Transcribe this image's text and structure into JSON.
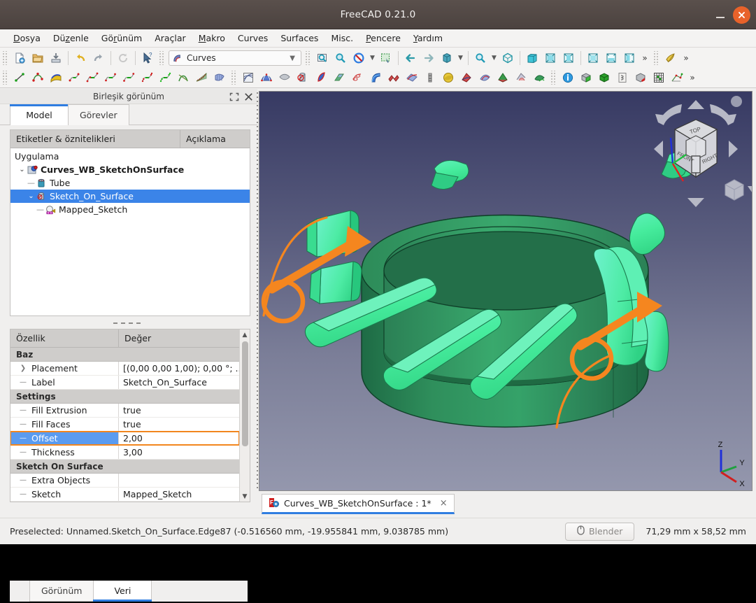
{
  "window": {
    "title": "FreeCAD 0.21.0",
    "minimize_label": "minimize",
    "close_label": "close"
  },
  "menubar": {
    "items": [
      {
        "label": "Dosya",
        "mnemonic": "D"
      },
      {
        "label": "Düzenle",
        "mnemonic": "z"
      },
      {
        "label": "Görünüm",
        "mnemonic": "r"
      },
      {
        "label": "Araçlar",
        "mnemonic": ""
      },
      {
        "label": "Makro",
        "mnemonic": "M"
      },
      {
        "label": "Curves",
        "mnemonic": ""
      },
      {
        "label": "Surfaces",
        "mnemonic": ""
      },
      {
        "label": "Misc.",
        "mnemonic": ""
      },
      {
        "label": "Pencere",
        "mnemonic": "P"
      },
      {
        "label": "Yardım",
        "mnemonic": "Y"
      }
    ]
  },
  "toolbar": {
    "workbench_selector": {
      "value": "Curves",
      "icon": "curves-workbench-icon"
    },
    "row1_icons": [
      "new-document-icon",
      "open-document-icon",
      "save-document-icon",
      "undo-icon",
      "redo-icon",
      "refresh-icon",
      "whats-this-icon"
    ],
    "row1_view_icons": [
      "fit-all-icon",
      "fit-selection-icon",
      "draw-style-icon",
      "box-selection-icon",
      "back-icon",
      "forward-icon",
      "std-views-icon",
      "zoom-icon",
      "axonometric-icon",
      "front-view-icon",
      "top-view-icon",
      "right-view-icon",
      "rear-view-icon",
      "bottom-view-icon",
      "left-view-icon",
      "overflow-icon",
      "appearance-icon"
    ],
    "row2_curves_icons": [
      "line-icon",
      "bezier-curve-icon",
      "sketch-on-surface-icon",
      "blend-curve-icon",
      "curve-extend-icon",
      "join-curve-icon",
      "split-curve-icon",
      "discretize-icon",
      "approximate-icon",
      "interpolate-icon",
      "parametric-comb-icon",
      "zebra-icon"
    ],
    "row2_surface_icons": [
      "surface-analysis-icon",
      "gordon-surface-icon",
      "flatten-face-icon",
      "pipeshell-icon",
      "sublink-icon",
      "segment-surface-icon",
      "sweep2rails-icon",
      "tube-icon",
      "profile-support-icon",
      "mixed-curve-icon",
      "isocurve-icon",
      "sphere-icon",
      "solid-from-shell-icon",
      "curves-misc-icon",
      "boolean-icon",
      "paste-icon",
      "trim-icon",
      "info-icon",
      "part-cube-icon",
      "green-cube-icon",
      "section-icon",
      "shape-info-icon",
      "grid-icon",
      "sketcher-icon"
    ],
    "overflow_label": "»"
  },
  "left_dock": {
    "header": {
      "title": "Birleşik görünüm",
      "float_icon": "float-panel-icon",
      "close_icon": "close-panel-icon"
    },
    "top_tabs": [
      {
        "label": "Model",
        "active": true
      },
      {
        "label": "Görevler",
        "active": false
      }
    ],
    "bottom_tabs": [
      {
        "label": "Görünüm",
        "active": false
      },
      {
        "label": "Veri",
        "active": true
      }
    ],
    "tree": {
      "columns": [
        "Etiketler & öznitelikleri",
        "Açıklama"
      ],
      "rows": [
        {
          "label": "Uygulama",
          "depth": 0,
          "arrow": "",
          "icon": "",
          "bold": false,
          "selected": false
        },
        {
          "label": "Curves_WB_SketchOnSurface",
          "depth": 1,
          "arrow": "expanded",
          "icon": "document-icon",
          "bold": true,
          "selected": false
        },
        {
          "label": "Tube",
          "depth": 2,
          "arrow": "none",
          "icon": "tube-object-icon",
          "bold": false,
          "selected": false
        },
        {
          "label": "Sketch_On_Surface",
          "depth": 2,
          "arrow": "expanded",
          "icon": "sketch-on-surface-object-icon",
          "bold": false,
          "selected": true
        },
        {
          "label": "Mapped_Sketch",
          "depth": 3,
          "arrow": "none",
          "icon": "sketch-object-icon",
          "bold": false,
          "selected": false
        }
      ]
    },
    "properties": {
      "columns": [
        "Özellik",
        "Değer"
      ],
      "rows": [
        {
          "kind": "group",
          "key": "Baz"
        },
        {
          "kind": "prop",
          "key": "Placement",
          "value": "[(0,00 0,00 1,00); 0,00 °; ...",
          "expandable": true,
          "selected": false,
          "highlighted": false
        },
        {
          "kind": "prop",
          "key": "Label",
          "value": "Sketch_On_Surface",
          "expandable": false,
          "selected": false,
          "highlighted": false
        },
        {
          "kind": "group",
          "key": "Settings"
        },
        {
          "kind": "prop",
          "key": "Fill Extrusion",
          "value": "true",
          "expandable": false,
          "selected": false,
          "highlighted": false
        },
        {
          "kind": "prop",
          "key": "Fill Faces",
          "value": "true",
          "expandable": false,
          "selected": false,
          "highlighted": false
        },
        {
          "kind": "prop",
          "key": "Offset",
          "value": "2,00",
          "expandable": false,
          "selected": true,
          "highlighted": true
        },
        {
          "kind": "prop",
          "key": "Thickness",
          "value": "3,00",
          "expandable": false,
          "selected": false,
          "highlighted": false
        },
        {
          "kind": "group",
          "key": "Sketch On Surface"
        },
        {
          "kind": "prop",
          "key": "Extra Objects",
          "value": "",
          "expandable": false,
          "selected": false,
          "highlighted": false
        },
        {
          "kind": "prop",
          "key": "Sketch",
          "value": "Mapped_Sketch",
          "expandable": false,
          "selected": false,
          "highlighted": false
        }
      ]
    }
  },
  "viewport": {
    "document_tab": {
      "label": "Curves_WB_SketchOnSurface : 1*",
      "icon": "freecad-document-icon",
      "close_label": "×"
    },
    "nav_cube": {
      "faces": [
        "TOP",
        "FRONT",
        "RIGHT"
      ],
      "arrow_up": "nav-arrow-up",
      "arrow_down": "nav-arrow-down",
      "arrow_left": "nav-arrow-left",
      "arrow_right": "nav-arrow-right",
      "rotate_left": "nav-rotate-ccw",
      "rotate_right": "nav-rotate-cw",
      "home_dot": "nav-home-dot",
      "corner_cube": "nav-corner-cube"
    },
    "axis_indicator": {
      "x": "X",
      "y": "Y",
      "z": "Z"
    },
    "colors": {
      "background_top": "#373a63",
      "background_bottom": "#9497ad",
      "tube_body": "#2e8b5a",
      "tube_highlight": "#3fa46d",
      "tabs_bright": "#45e89a",
      "tabs_cyan": "#5df0c8",
      "annotation": "#f2861e"
    }
  },
  "statusbar": {
    "message": "Preselected: Unnamed.Sketch_On_Surface.Edge87 (-0.516560 mm, -19.955841 mm, 9.038785 mm)",
    "nav_style_button": {
      "label": "Blender",
      "icon": "mouse-icon"
    },
    "dimensions": "71,29 mm x 58,52 mm"
  }
}
